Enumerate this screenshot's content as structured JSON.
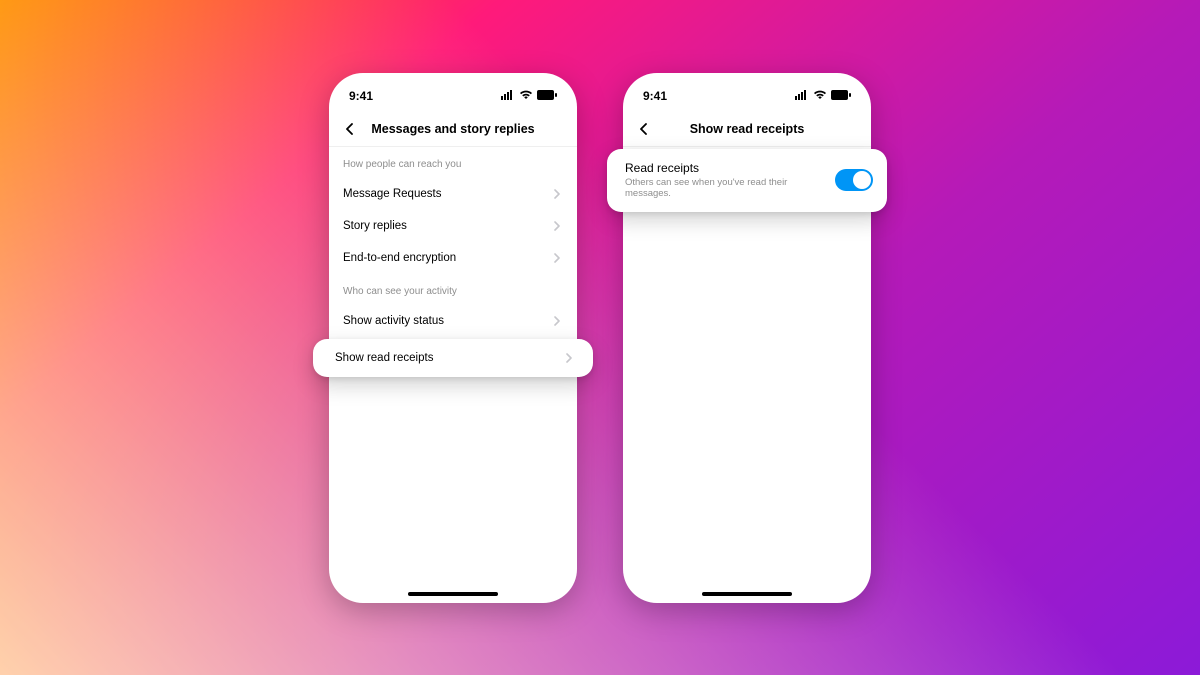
{
  "status": {
    "time": "9:41"
  },
  "phone1": {
    "title": "Messages and story replies",
    "section1": "How people can reach you",
    "rows1": [
      {
        "label": "Message Requests"
      },
      {
        "label": "Story replies"
      },
      {
        "label": "End-to-end encryption"
      }
    ],
    "section2": "Who can see your activity",
    "rows2_0": "Show activity status",
    "highlight": "Show read receipts"
  },
  "phone2": {
    "title": "Show read receipts",
    "card_title": "Read receipts",
    "card_sub": "Others can see when you've read their messages."
  }
}
